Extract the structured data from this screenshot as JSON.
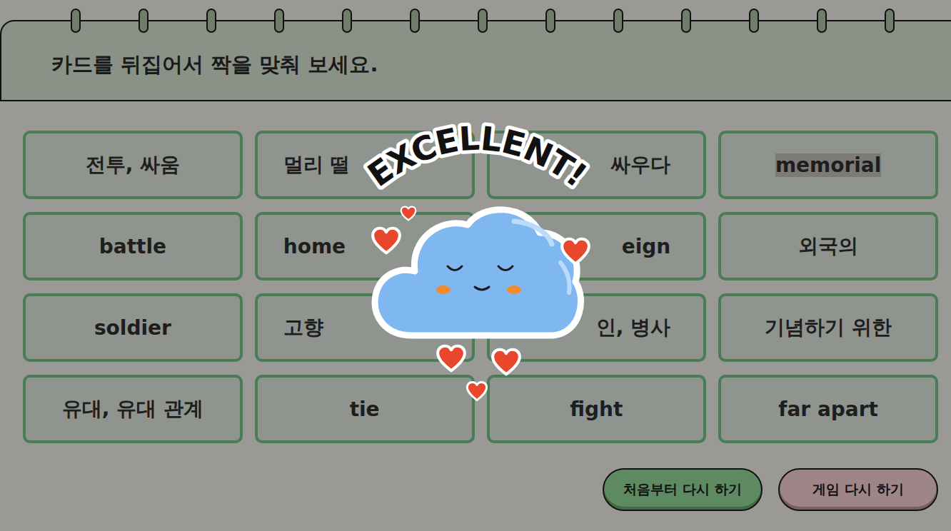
{
  "instruction": "카드를 뒤집어서 짝을 맞춰 보세요.",
  "cards": [
    {
      "text": "전투, 싸움",
      "kind": "whole",
      "highlighted": false
    },
    {
      "text": "멀리 떨",
      "kind": "cut-end",
      "highlighted": false
    },
    {
      "text": "싸우다",
      "kind": "cut-start",
      "highlighted": false
    },
    {
      "text": "memorial",
      "kind": "whole",
      "highlighted": true
    },
    {
      "text": "battle",
      "kind": "whole",
      "highlighted": false
    },
    {
      "text": "home",
      "kind": "cut-end",
      "highlighted": false
    },
    {
      "text": "eign",
      "kind": "cut-start",
      "highlighted": false
    },
    {
      "text": "외국의",
      "kind": "whole",
      "highlighted": false
    },
    {
      "text": "soldier",
      "kind": "whole",
      "highlighted": false
    },
    {
      "text": "고향",
      "kind": "cut-end",
      "highlighted": false
    },
    {
      "text": "인, 병사",
      "kind": "cut-start",
      "highlighted": false
    },
    {
      "text": "기념하기 위한",
      "kind": "whole",
      "highlighted": false
    },
    {
      "text": "유대, 유대 관계",
      "kind": "whole",
      "highlighted": false
    },
    {
      "text": "tie",
      "kind": "whole",
      "highlighted": false
    },
    {
      "text": "fight",
      "kind": "whole",
      "highlighted": false
    },
    {
      "text": "far apart",
      "kind": "whole",
      "highlighted": false
    }
  ],
  "overlay": {
    "title": "EXCELLENT!"
  },
  "buttons": [
    {
      "label": "처음부터 다시 하기",
      "kind": "primary"
    },
    {
      "label": "게임 다시 하기",
      "kind": "secondary"
    }
  ]
}
